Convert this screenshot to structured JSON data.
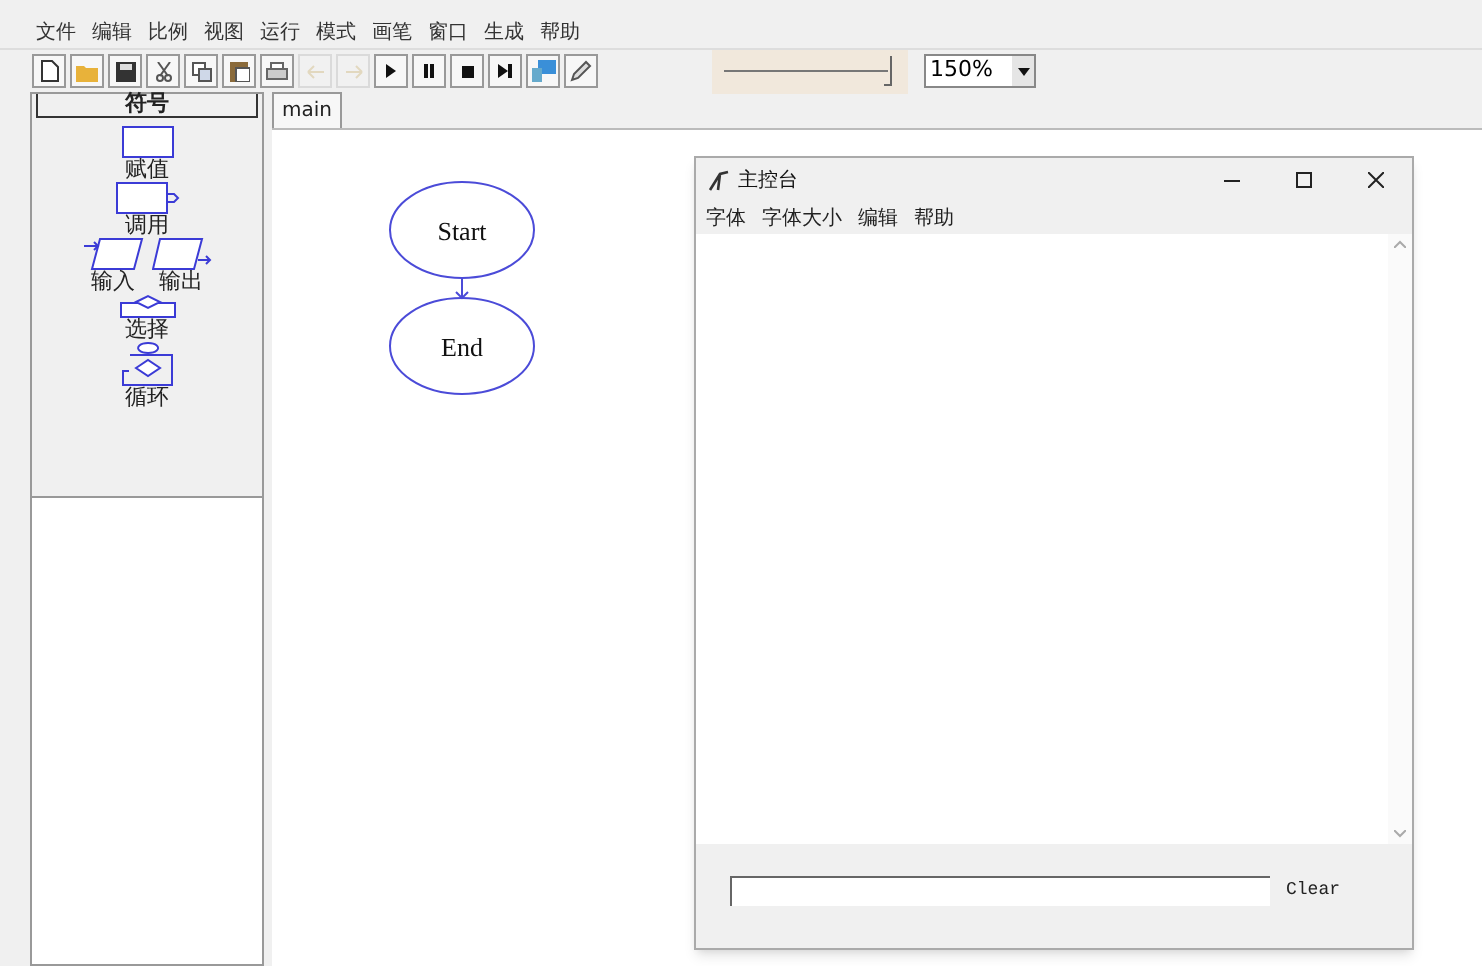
{
  "menu_bar": [
    "文件",
    "编辑",
    "比例",
    "视图",
    "运行",
    "模式",
    "画笔",
    "窗口",
    "生成",
    "帮助"
  ],
  "toolbar": {
    "buttons": [
      {
        "kind": "new",
        "disabled": false
      },
      {
        "kind": "open",
        "disabled": false
      },
      {
        "kind": "save",
        "disabled": false
      },
      {
        "kind": "cut",
        "disabled": false
      },
      {
        "kind": "copy",
        "disabled": false
      },
      {
        "kind": "paste",
        "disabled": false
      },
      {
        "kind": "print",
        "disabled": false
      },
      {
        "kind": "undo",
        "disabled": true
      },
      {
        "kind": "redo",
        "disabled": true
      },
      {
        "kind": "play",
        "disabled": false
      },
      {
        "kind": "pause",
        "disabled": false
      },
      {
        "kind": "stop",
        "disabled": false
      },
      {
        "kind": "step",
        "disabled": false
      },
      {
        "kind": "monitor",
        "disabled": false
      },
      {
        "kind": "pen",
        "disabled": false
      }
    ],
    "speed_slider": {
      "level": 0.98
    },
    "zoom": {
      "value": "150%"
    }
  },
  "symbols_panel": {
    "title": "符号",
    "symbols": [
      {
        "kind": "assignment",
        "label": "赋值"
      },
      {
        "kind": "call",
        "label": "调用"
      },
      {
        "kind": "input",
        "label": "输入"
      },
      {
        "kind": "output",
        "label": "输出"
      },
      {
        "kind": "selection",
        "label": "选择"
      },
      {
        "kind": "loop",
        "label": "循环"
      }
    ]
  },
  "tabs": [
    {
      "label": "main",
      "selected": true
    }
  ],
  "flowchart": {
    "nodes": [
      {
        "label": "Start"
      },
      {
        "label": "End"
      }
    ]
  },
  "console": {
    "title": "主控台",
    "menu": [
      "字体",
      "字体大小",
      "编辑",
      "帮助"
    ],
    "clear_button": "Clear"
  }
}
